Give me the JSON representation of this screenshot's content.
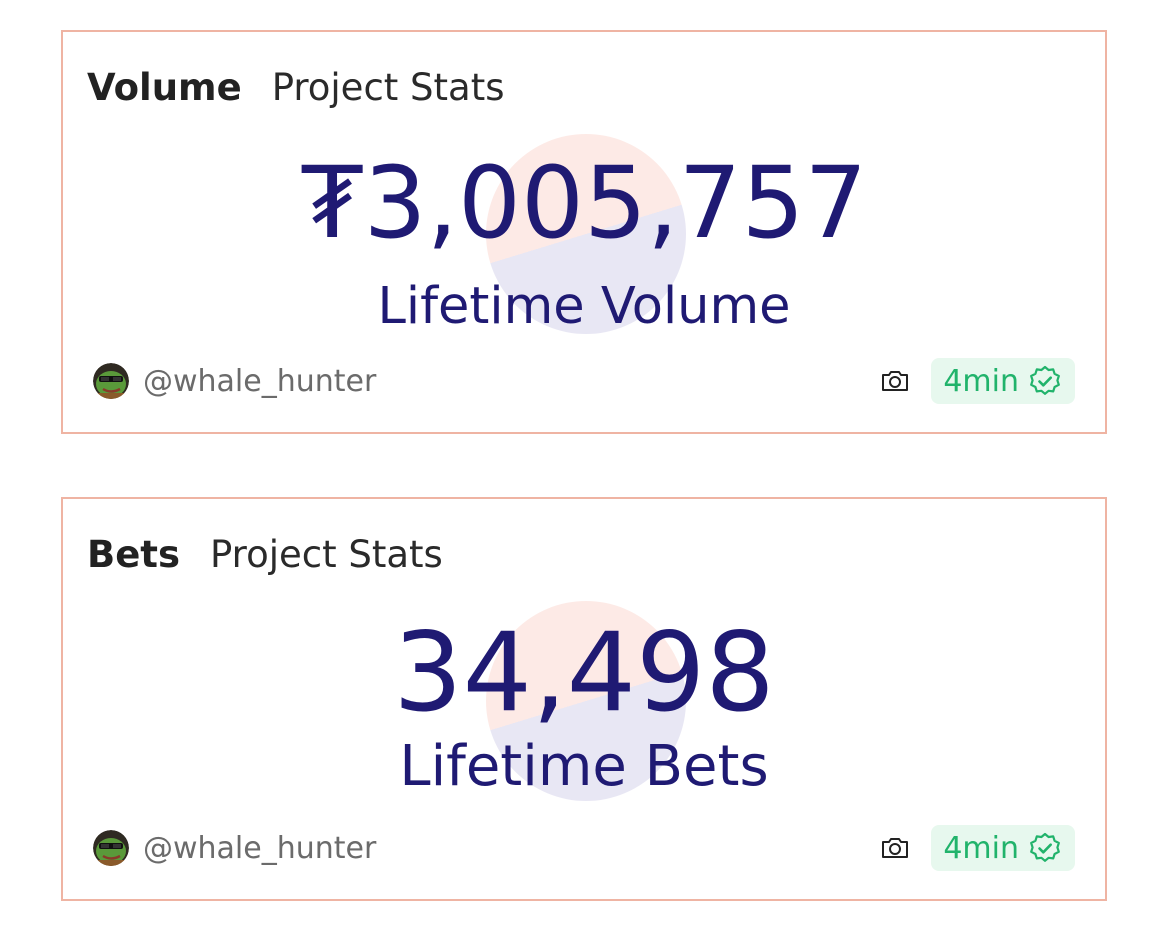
{
  "cards": [
    {
      "kind": "Volume",
      "subtitle": "Project Stats",
      "value": "₮3,005,757",
      "caption": "Lifetime Volume",
      "user": {
        "handle": "@whale_hunter",
        "avatar_icon": "pepe-avatar-icon"
      },
      "badge": {
        "time": "4min",
        "icon": "verified-check-icon"
      },
      "camera_icon": "camera-icon"
    },
    {
      "kind": "Bets",
      "subtitle": "Project Stats",
      "value": "34,498",
      "caption": "Lifetime Bets",
      "user": {
        "handle": "@whale_hunter",
        "avatar_icon": "pepe-avatar-icon"
      },
      "badge": {
        "time": "4min",
        "icon": "verified-check-icon"
      },
      "camera_icon": "camera-icon"
    }
  ],
  "colors": {
    "card_border": "#efb4a3",
    "value_text": "#1f1a73",
    "badge_bg": "#e7f8ee",
    "badge_text": "#21b36b",
    "handle_text": "#6b6b6b"
  }
}
